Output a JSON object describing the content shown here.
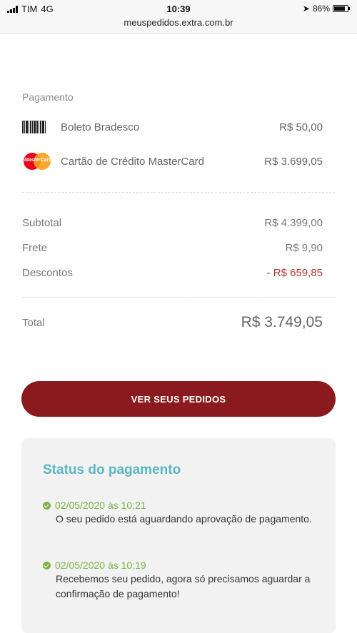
{
  "status_bar": {
    "carrier": "TIM",
    "network": "4G",
    "time": "10:39",
    "battery": "86%",
    "battery_level": 0.86,
    "url": "meuspedidos.extra.com.br"
  },
  "payment": {
    "section_label": "Pagamento",
    "methods": [
      {
        "icon": "barcode-icon",
        "name": "Boleto Bradesco",
        "value": "R$ 50,00"
      },
      {
        "icon": "mastercard-icon",
        "icon_text": "MasterCard",
        "name": "Cartão de Crédito MasterCard",
        "value": "R$ 3.699,05"
      }
    ]
  },
  "summary": {
    "subtotal_label": "Subtotal",
    "subtotal_value": "R$ 4.399,00",
    "frete_label": "Frete",
    "frete_value": "R$ 9,90",
    "descontos_label": "Descontos",
    "descontos_value": "- R$ 659,85",
    "total_label": "Total",
    "total_value": "R$ 3.749,05"
  },
  "cta": {
    "label": "VER SEUS PEDIDOS"
  },
  "status": {
    "title": "Status do pagamento",
    "events": [
      {
        "date": "02/05/2020 às 10:21",
        "text": "O seu pedido está aguardando aprovação de pagamento."
      },
      {
        "date": "02/05/2020 às 10:19",
        "text": "Recebemos seu pedido, agora só precisamos aguardar a confirmação de pagamento!"
      }
    ]
  },
  "colors": {
    "accent_button": "#8b1a1f",
    "status_title": "#5bb7c2",
    "event_green": "#7db24a",
    "discount_red": "#b03a2e"
  }
}
